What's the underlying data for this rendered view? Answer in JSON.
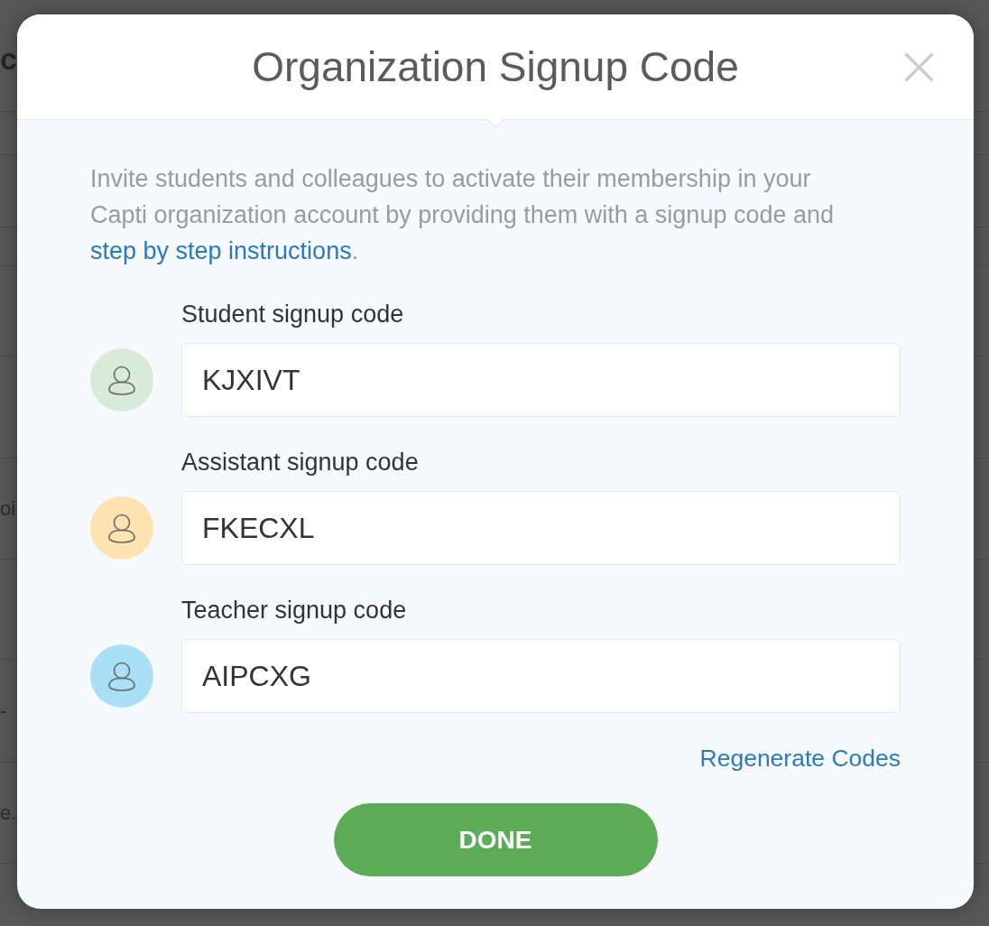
{
  "backdrop": {
    "heading": "c",
    "cells": [
      "oi",
      "-",
      "e."
    ]
  },
  "dialog": {
    "title": "Organization Signup Code",
    "intro": {
      "text": "Invite students and colleagues to activate their membership in your Capti organization account by providing them with a signup code and",
      "link": "step by step instructions",
      "after": "."
    },
    "codes": [
      {
        "label": "Student signup code",
        "value": "KJXIVT",
        "color": "#d7ebd8"
      },
      {
        "label": "Assistant signup code",
        "value": "FKECXL",
        "color": "#fde3b0"
      },
      {
        "label": "Teacher signup code",
        "value": "AIPCXG",
        "color": "#a9e0f7"
      }
    ],
    "regenerate_link": "Regenerate Codes",
    "done_button": "DONE"
  }
}
